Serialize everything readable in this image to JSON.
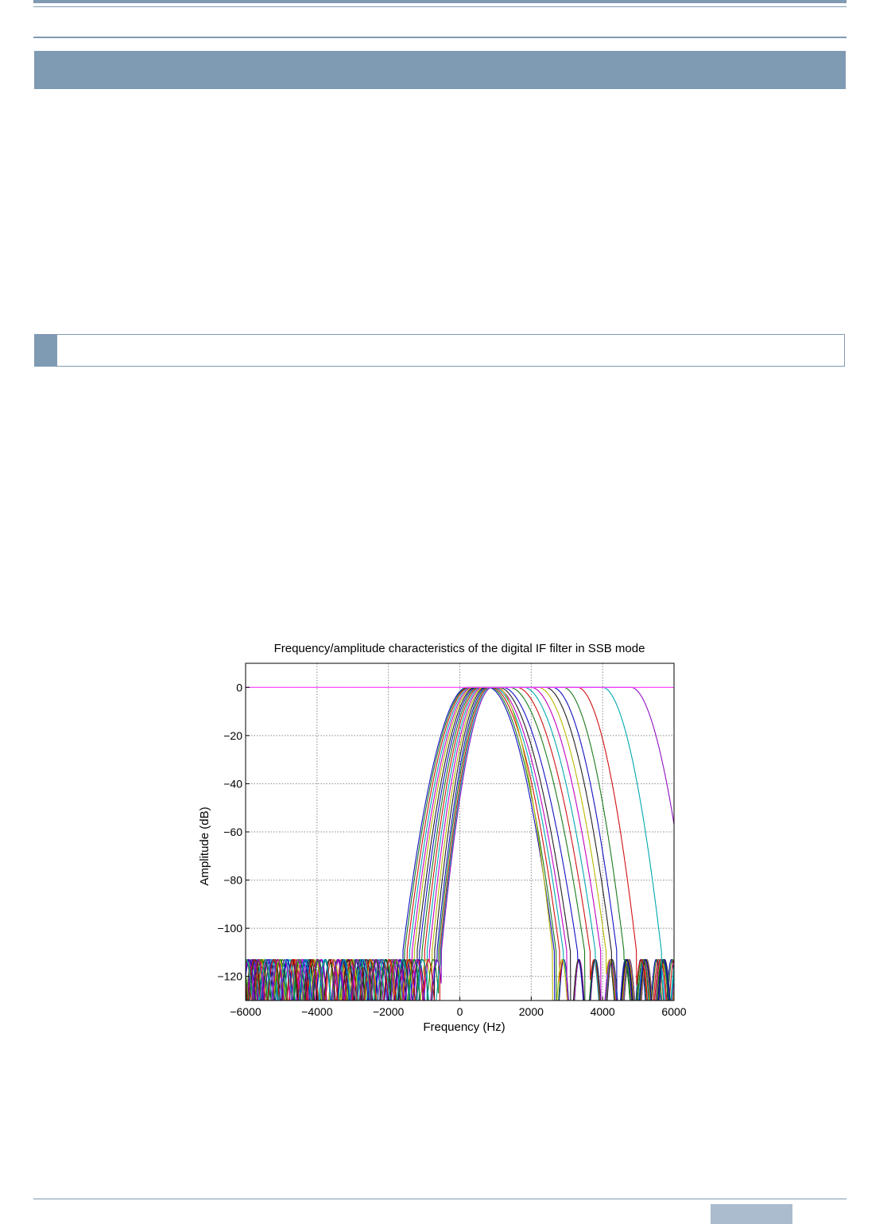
{
  "page": {
    "accent_color": "#7f9ab3",
    "tab_color": "#aabccd"
  },
  "chart_data": {
    "type": "line",
    "title": "Frequency/amplitude characteristics of the digital IF filter in SSB mode",
    "xlabel": "Frequency (Hz)",
    "ylabel": "Amplitude (dB)",
    "xlim": [
      -6000,
      6000
    ],
    "ylim": [
      -130,
      10
    ],
    "xticks": [
      -6000,
      -4000,
      -2000,
      0,
      2000,
      4000,
      6000
    ],
    "yticks": [
      0,
      -20,
      -40,
      -60,
      -80,
      -100,
      -120
    ],
    "xtick_labels": [
      "−6000",
      "−4000",
      "−2000",
      "0",
      "2000",
      "4000",
      "6000"
    ],
    "ytick_labels": [
      "0",
      "−20",
      "−40",
      "−60",
      "−80",
      "−100",
      "−120"
    ],
    "grid": true,
    "legend": "none",
    "stopband_floor_db": -110,
    "series": [
      {
        "color": "#1010c0",
        "low_cut_hz": -1600,
        "passband_hz": [
          200,
          800
        ],
        "high_cut_hz": 2650
      },
      {
        "color": "#1a7a1a",
        "low_cut_hz": -1550,
        "passband_hz": [
          230,
          850
        ],
        "high_cut_hz": 2700
      },
      {
        "color": "#d01010",
        "low_cut_hz": -1480,
        "passband_hz": [
          260,
          900
        ],
        "high_cut_hz": 2800
      },
      {
        "color": "#00a8b0",
        "low_cut_hz": -1410,
        "passband_hz": [
          300,
          950
        ],
        "high_cut_hz": 2900
      },
      {
        "color": "#c000c0",
        "low_cut_hz": -1340,
        "passband_hz": [
          340,
          1000
        ],
        "high_cut_hz": 3000
      },
      {
        "color": "#b8b800",
        "low_cut_hz": -1280,
        "passband_hz": [
          380,
          1050
        ],
        "high_cut_hz": 2600
      },
      {
        "color": "#202020",
        "low_cut_hz": -1200,
        "passband_hz": [
          420,
          1100
        ],
        "high_cut_hz": 3100
      },
      {
        "color": "#1010c0",
        "low_cut_hz": -1130,
        "passband_hz": [
          460,
          1200
        ],
        "high_cut_hz": 3300
      },
      {
        "color": "#1a7a1a",
        "low_cut_hz": -1060,
        "passband_hz": [
          500,
          1400
        ],
        "high_cut_hz": 3500
      },
      {
        "color": "#d01010",
        "low_cut_hz": -990,
        "passband_hz": [
          540,
          1600
        ],
        "high_cut_hz": 3650
      },
      {
        "color": "#00a8b0",
        "low_cut_hz": -920,
        "passband_hz": [
          580,
          1800
        ],
        "high_cut_hz": 3800
      },
      {
        "color": "#c000c0",
        "low_cut_hz": -850,
        "passband_hz": [
          620,
          2000
        ],
        "high_cut_hz": 3950
      },
      {
        "color": "#b8b800",
        "low_cut_hz": -780,
        "passband_hz": [
          660,
          2200
        ],
        "high_cut_hz": 4100
      },
      {
        "color": "#202020",
        "low_cut_hz": -710,
        "passband_hz": [
          700,
          2400
        ],
        "high_cut_hz": 4250
      },
      {
        "color": "#1010c0",
        "low_cut_hz": -640,
        "passband_hz": [
          740,
          2600
        ],
        "high_cut_hz": 4400
      },
      {
        "color": "#1a7a1a",
        "low_cut_hz": -600,
        "passband_hz": [
          780,
          2900
        ],
        "high_cut_hz": 4600
      },
      {
        "color": "#d01010",
        "low_cut_hz": -560,
        "passband_hz": [
          820,
          3300
        ],
        "high_cut_hz": 4950
      },
      {
        "color": "#00a8b0",
        "low_cut_hz": -540,
        "passband_hz": [
          860,
          4000
        ],
        "high_cut_hz": 5650
      },
      {
        "color": "#9010c0",
        "low_cut_hz": -520,
        "passband_hz": [
          900,
          4800
        ],
        "high_cut_hz": 6500
      },
      {
        "color": "#ff40ff",
        "low_cut_hz": -6000,
        "passband_hz": [
          -6000,
          6000
        ],
        "high_cut_hz": 6000
      }
    ]
  }
}
